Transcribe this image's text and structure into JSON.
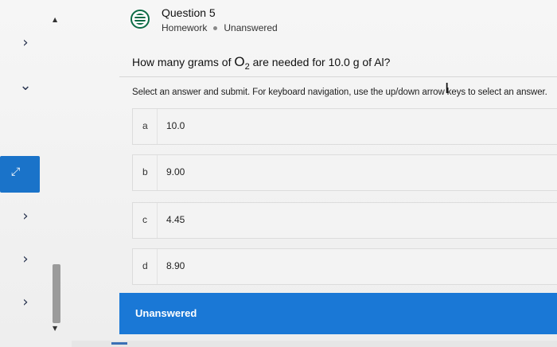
{
  "header": {
    "title": "Question 5",
    "category": "Homework",
    "status": "Unanswered"
  },
  "question": {
    "prefix": "How many grams of ",
    "formula_base": "O",
    "formula_sub": "2",
    "suffix": " are needed for 10.0 g of Al?"
  },
  "instructions": "Select an answer and submit. For keyboard navigation, use the up/down arrow keys to select an answer.",
  "options": [
    {
      "letter": "a",
      "value": "10.0"
    },
    {
      "letter": "b",
      "value": "9.00"
    },
    {
      "letter": "c",
      "value": "4.45"
    },
    {
      "letter": "d",
      "value": "8.90"
    }
  ],
  "submit_bar": {
    "label": "Unanswered",
    "color": "#1a78d6"
  },
  "sidebar": {
    "items": [
      {
        "icon": "chevron-right-icon",
        "glyph": "›"
      },
      {
        "icon": "chevron-down-icon",
        "glyph": "⌄"
      },
      {
        "icon": "expand-icon",
        "glyph": "⤢"
      },
      {
        "icon": "chevron-right-icon",
        "glyph": "›"
      },
      {
        "icon": "chevron-right-icon",
        "glyph": "›"
      },
      {
        "icon": "chevron-right-icon",
        "glyph": "›"
      }
    ]
  },
  "colors": {
    "accent": "#1a78d6",
    "icon_green": "#0b6b45"
  }
}
